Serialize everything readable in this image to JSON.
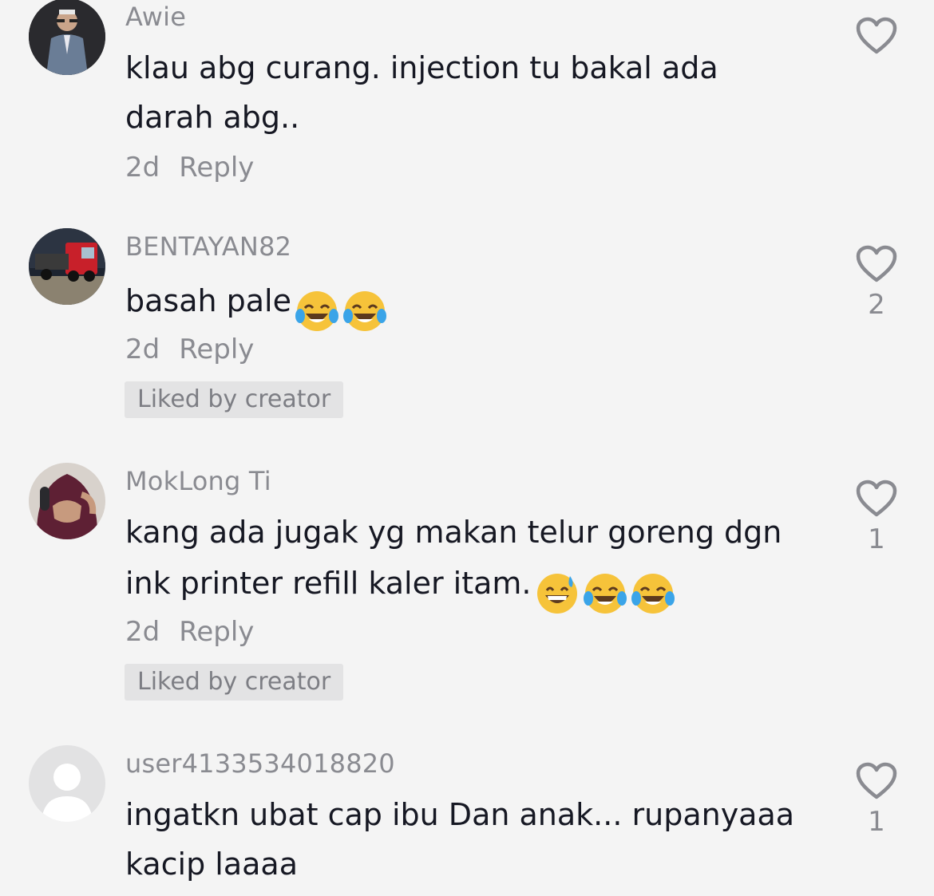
{
  "comments": [
    {
      "username": "Awie",
      "text_lines": [
        "klau abg curang. injection tu bakal ada",
        "darah abg.."
      ],
      "time": "2d",
      "reply_label": "Reply",
      "like_count": "",
      "liked_by_creator": ""
    },
    {
      "username": "BENTAYAN82",
      "text_lines": [
        "basah pale"
      ],
      "emojis": [
        "face-with-tears-of-joy",
        "face-with-tears-of-joy"
      ],
      "time": "2d",
      "reply_label": "Reply",
      "like_count": "2",
      "liked_by_creator": "Liked by creator"
    },
    {
      "username": "MokLong Ti",
      "text_lines": [
        "kang ada jugak yg makan telur goreng dgn",
        "ink printer refill kaler itam."
      ],
      "emojis": [
        "grinning-face-with-sweat",
        "face-with-tears-of-joy",
        "face-with-tears-of-joy"
      ],
      "time": "2d",
      "reply_label": "Reply",
      "like_count": "1",
      "liked_by_creator": "Liked by creator"
    },
    {
      "username": "user4133534018820",
      "text_lines": [
        "ingatkn ubat cap ibu Dan anak... rupanyaaa",
        "kacip laaaa"
      ],
      "like_count": "1"
    }
  ],
  "colors": {
    "background": "#f4f4f4",
    "text": "#161823",
    "muted": "#8a8b91",
    "badge_bg": "#e3e3e4"
  },
  "icons": {
    "like": "heart-outline-icon",
    "default_avatar": "user-silhouette-icon"
  }
}
